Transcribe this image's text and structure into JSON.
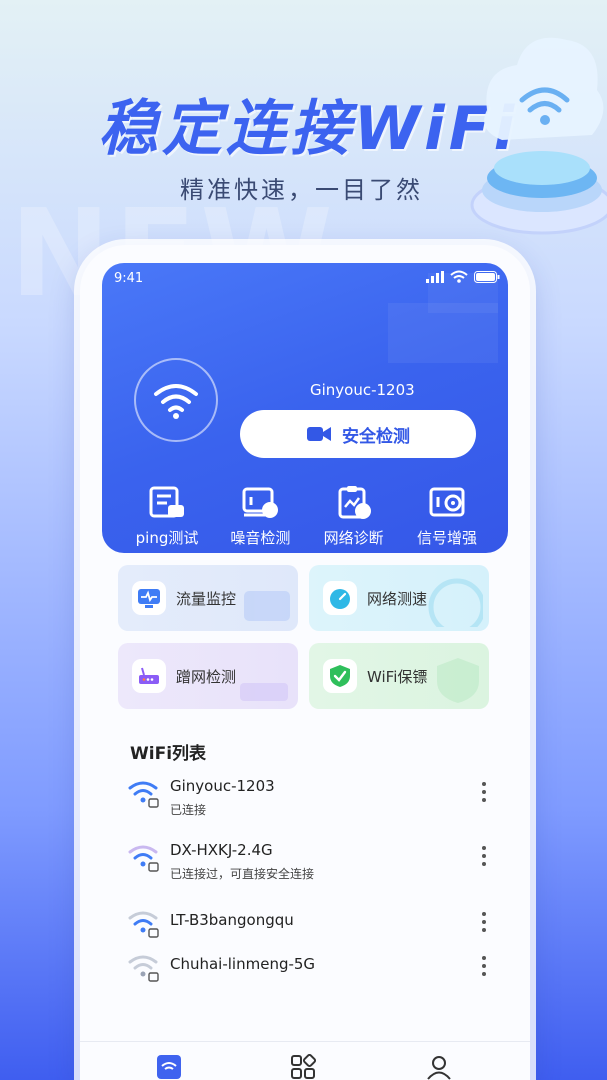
{
  "hero": {
    "title": "稳定连接WiFi",
    "subtitle": "精准快速，一目了然",
    "watermark": "NEW"
  },
  "status_bar": {
    "time": "9:41"
  },
  "connection": {
    "ssid": "Ginyouc-1203",
    "check_label": "安全检测"
  },
  "tools": [
    {
      "label": "ping测试",
      "icon": "ping-test-icon"
    },
    {
      "label": "噪音检测",
      "icon": "noise-detect-icon"
    },
    {
      "label": "网络诊断",
      "icon": "network-diagnose-icon"
    },
    {
      "label": "信号增强",
      "icon": "signal-boost-icon"
    }
  ],
  "tiles": [
    {
      "label": "流量监控",
      "icon": "traffic-monitor-icon",
      "color": "#3f7cf5"
    },
    {
      "label": "网络测速",
      "icon": "speed-test-icon",
      "color": "#2fb8e6"
    },
    {
      "label": "蹭网检测",
      "icon": "router-icon",
      "color": "#8b5cf6"
    },
    {
      "label": "WiFi保镖",
      "icon": "shield-check-icon",
      "color": "#2fbf5b"
    }
  ],
  "wifi_list": {
    "title": "WiFi列表",
    "items": [
      {
        "name": "Ginyouc-1203",
        "status": "已连接"
      },
      {
        "name": "DX-HXKJ-2.4G",
        "status": "已连接过，可直接安全连接"
      },
      {
        "name": "LT-B3bangongqu",
        "status": ""
      },
      {
        "name": "Chuhai-linmeng-5G",
        "status": ""
      }
    ]
  },
  "colors": {
    "accent": "#3c63f0",
    "card": "#3a63ee"
  }
}
